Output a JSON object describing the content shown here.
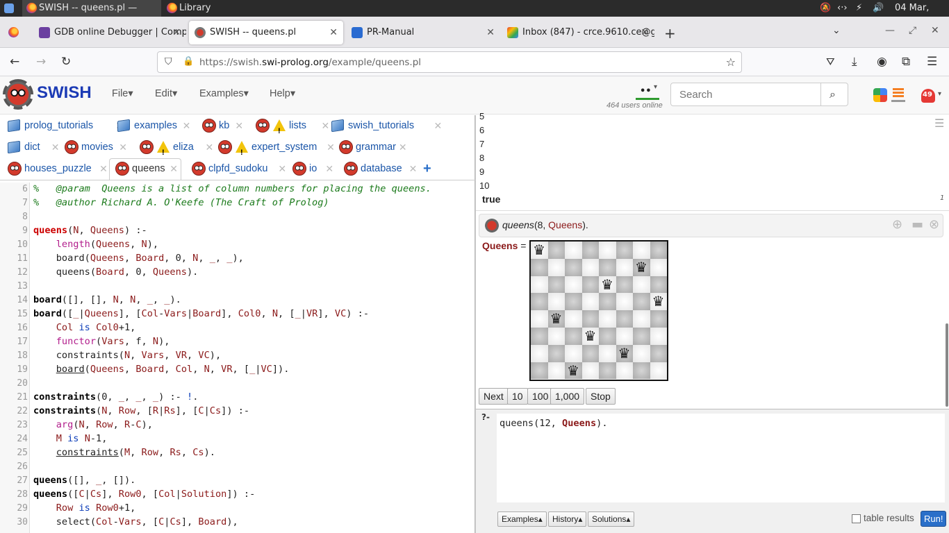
{
  "os": {
    "tasks": [
      "SWISH -- queens.pl — Mozill...",
      "Library"
    ],
    "clock": "04 Mar, 19:47"
  },
  "browser": {
    "tabs": [
      {
        "label": "GDB online Debugger | Compiler",
        "color": "#6b3fa0"
      },
      {
        "label": "SWISH -- queens.pl",
        "color": "#888888"
      },
      {
        "label": "PR-Manual",
        "color": "#2a6bd1"
      },
      {
        "label": "Inbox (847) - crce.9610.ce@gmail.com",
        "color": "#d93025"
      }
    ],
    "url_prefix": "https://swish.",
    "url_domain": "swi-prolog.org",
    "url_path": "/example/queens.pl"
  },
  "swish": {
    "logo": "SWISH",
    "menus": [
      "File",
      "Edit",
      "Examples",
      "Help"
    ],
    "search_placeholder": "Search",
    "users_online": "464 users online",
    "notifications": "49"
  },
  "file_tabs": [
    [
      {
        "label": "prolog_tutorials",
        "icon": "book"
      },
      {
        "label": "examples",
        "icon": "book"
      },
      {
        "label": "kb",
        "icon": "owl"
      },
      {
        "label": "lists",
        "icon": "owl-warn"
      },
      {
        "label": "swish_tutorials",
        "icon": "book"
      }
    ],
    [
      {
        "label": "dict",
        "icon": "book"
      },
      {
        "label": "movies",
        "icon": "owl"
      },
      {
        "label": "eliza",
        "icon": "owl-warn"
      },
      {
        "label": "expert_system",
        "icon": "owl-warn"
      },
      {
        "label": "grammar",
        "icon": "owl"
      }
    ],
    [
      {
        "label": "houses_puzzle",
        "icon": "owl"
      },
      {
        "label": "queens",
        "icon": "owl"
      },
      {
        "label": "clpfd_sudoku",
        "icon": "owl"
      },
      {
        "label": "io",
        "icon": "owl"
      },
      {
        "label": "database",
        "icon": "owl"
      }
    ]
  ],
  "code_lines": [
    {
      "n": "6",
      "html": "<span class=\"cm\">%   @param  Queens is a list of column numbers for placing the queens.</span>"
    },
    {
      "n": "7",
      "html": "<span class=\"cm\">%   @author Richard A. O'Keefe (The Craft of Prolog)</span>"
    },
    {
      "n": "8",
      "html": ""
    },
    {
      "n": "9",
      "html": "<span class=\"hd\">queens</span>(<span class=\"va\">N</span>, <span class=\"va\">Queens</span>) :-"
    },
    {
      "n": "10",
      "html": "    <span class=\"bi\">length</span>(<span class=\"va\">Queens</span>, <span class=\"va\">N</span>),"
    },
    {
      "n": "11",
      "html": "    board(<span class=\"va\">Queens</span>, <span class=\"va\">Board</span>, 0, <span class=\"va\">N</span>, <span class=\"va\">_</span>, <span class=\"va\">_</span>),"
    },
    {
      "n": "12",
      "html": "    queens(<span class=\"va\">Board</span>, 0, <span class=\"va\">Queens</span>)."
    },
    {
      "n": "13",
      "html": ""
    },
    {
      "n": "14",
      "html": "<span class=\"hb\">board</span>([], [], <span class=\"va\">N</span>, <span class=\"va\">N</span>, <span class=\"va\">_</span>, <span class=\"va\">_</span>)."
    },
    {
      "n": "15",
      "html": "<span class=\"hb\">board</span>([<span class=\"va\">_</span>|<span class=\"va\">Queens</span>], [<span class=\"va\">Col</span>-<span class=\"va\">Vars</span>|<span class=\"va\">Board</span>], <span class=\"va\">Col0</span>, <span class=\"va\">N</span>, [<span class=\"va\">_</span>|<span class=\"va\">VR</span>], <span class=\"va\">VC</span>) :-"
    },
    {
      "n": "16",
      "html": "    <span class=\"va\">Col</span> <span class=\"kw\">is</span> <span class=\"va\">Col0</span>+1,"
    },
    {
      "n": "17",
      "html": "    <span class=\"bi\">functor</span>(<span class=\"va\">Vars</span>, f, <span class=\"va\">N</span>),"
    },
    {
      "n": "18",
      "html": "    constraints(<span class=\"va\">N</span>, <span class=\"va\">Vars</span>, <span class=\"va\">VR</span>, <span class=\"va\">VC</span>),"
    },
    {
      "n": "19",
      "html": "    <span class=\"ul\">board</span>(<span class=\"va\">Queens</span>, <span class=\"va\">Board</span>, <span class=\"va\">Col</span>, <span class=\"va\">N</span>, <span class=\"va\">VR</span>, [<span class=\"va\">_</span>|<span class=\"va\">VC</span>])."
    },
    {
      "n": "20",
      "html": ""
    },
    {
      "n": "21",
      "html": "<span class=\"hb\">constraints</span>(0, <span class=\"va\">_</span>, <span class=\"va\">_</span>, <span class=\"va\">_</span>) :- <span class=\"kw\">!</span>."
    },
    {
      "n": "22",
      "html": "<span class=\"hb\">constraints</span>(<span class=\"va\">N</span>, <span class=\"va\">Row</span>, [<span class=\"va\">R</span>|<span class=\"va\">Rs</span>], [<span class=\"va\">C</span>|<span class=\"va\">Cs</span>]) :-"
    },
    {
      "n": "23",
      "html": "    <span class=\"bi\">arg</span>(<span class=\"va\">N</span>, <span class=\"va\">Row</span>, <span class=\"va\">R</span>-<span class=\"va\">C</span>),"
    },
    {
      "n": "24",
      "html": "    <span class=\"va\">M</span> <span class=\"kw\">is</span> <span class=\"va\">N</span>-1,"
    },
    {
      "n": "25",
      "html": "    <span class=\"ul\">constraints</span>(<span class=\"va\">M</span>, <span class=\"va\">Row</span>, <span class=\"va\">Rs</span>, <span class=\"va\">Cs</span>)."
    },
    {
      "n": "26",
      "html": ""
    },
    {
      "n": "27",
      "html": "<span class=\"hb\">queens</span>([], <span class=\"va\">_</span>, [])."
    },
    {
      "n": "28",
      "html": "<span class=\"hb\">queens</span>([<span class=\"va\">C</span>|<span class=\"va\">Cs</span>], <span class=\"va\">Row0</span>, [<span class=\"va\">Col</span>|<span class=\"va\">Solution</span>]) :-"
    },
    {
      "n": "29",
      "html": "    <span class=\"va\">Row</span> <span class=\"kw\">is</span> <span class=\"va\">Row0</span>+1,"
    },
    {
      "n": "30",
      "html": "    select(<span class=\"va\">Col</span>-<span class=\"va\">Vars</span>, [<span class=\"va\">C</span>|<span class=\"va\">Cs</span>], <span class=\"va\">Board</span>),"
    }
  ],
  "output": {
    "numbers": [
      "5",
      "6",
      "7",
      "8",
      "9",
      "10"
    ],
    "true_label": "true",
    "answer_count": "1",
    "query_pred": "queens",
    "query_args_pre": "(8, ",
    "query_var": "Queens",
    "query_end": ").",
    "binding_var": "Queens",
    "binding_eq": "=",
    "queen_columns": [
      1,
      5,
      8,
      6,
      3,
      7,
      2,
      4
    ],
    "buttons": [
      "Next",
      "10",
      "100",
      "1,000",
      "Stop"
    ]
  },
  "query_editor": {
    "prompt": "?-",
    "pred": "queens(12, ",
    "var": "Queens",
    "end": ").",
    "buttons": [
      "Examples",
      "History",
      "Solutions"
    ],
    "table_results": "table results",
    "run": "Run!"
  }
}
